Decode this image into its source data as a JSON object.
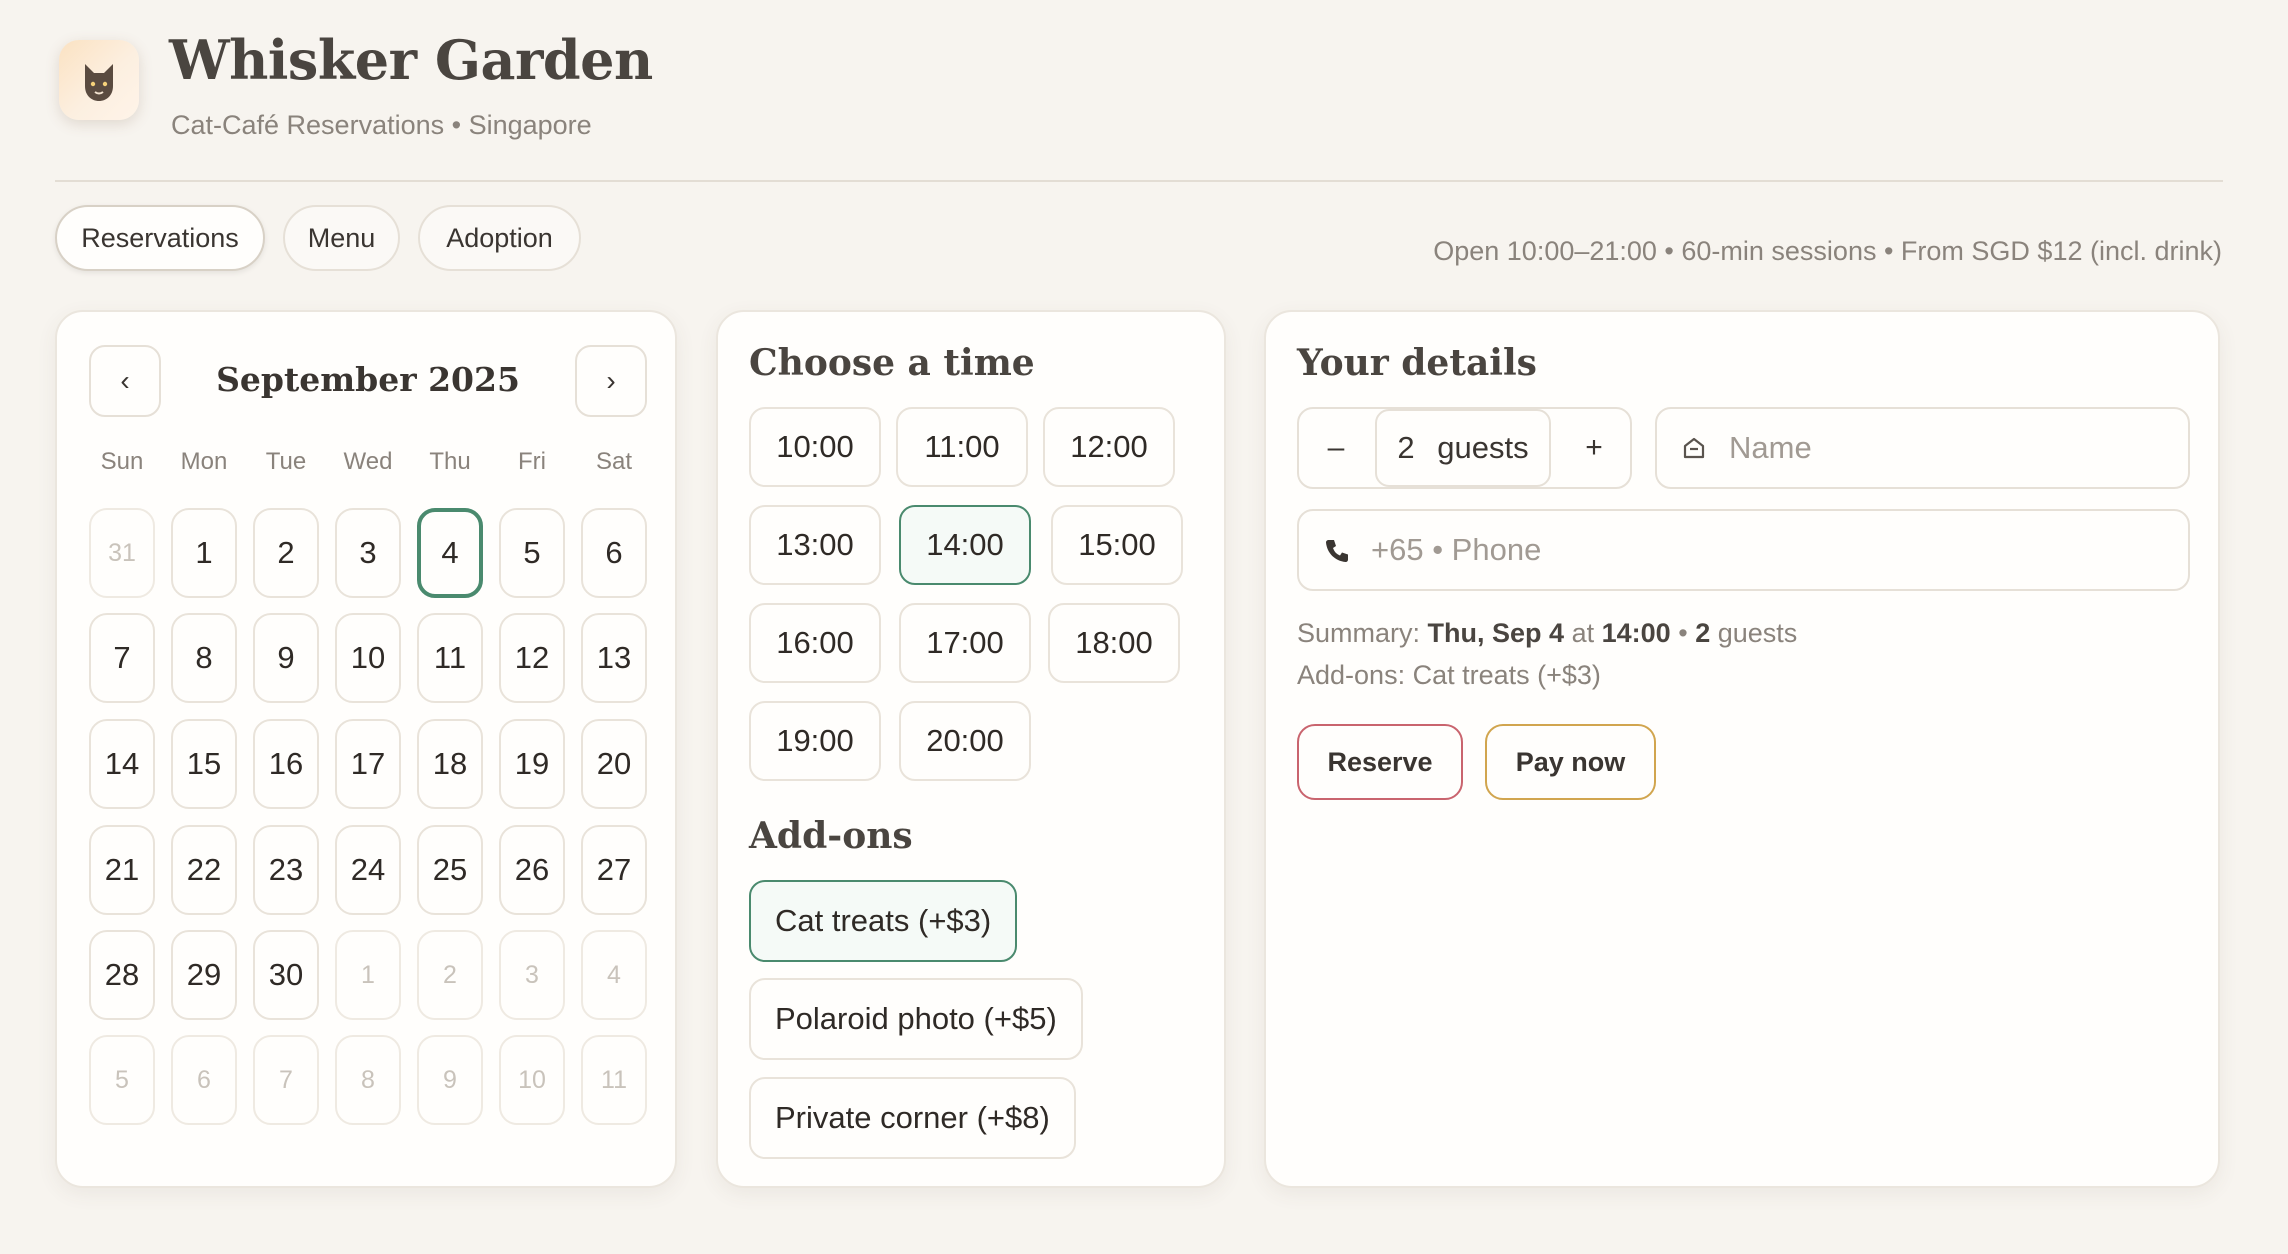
{
  "brand": {
    "name": "Whisker Garden",
    "subtitle": "Cat-Café Reservations • Singapore"
  },
  "tabs": [
    {
      "label": "Reservations",
      "active": true
    },
    {
      "label": "Menu",
      "active": false
    },
    {
      "label": "Adoption",
      "active": false
    }
  ],
  "info": "Open 10:00–21:00 • 60-min sessions • From SGD $12 (incl. drink)",
  "calendar": {
    "month": "September 2025",
    "prev": "‹",
    "next": "›",
    "weekdays": [
      "Sun",
      "Mon",
      "Tue",
      "Wed",
      "Thu",
      "Fri",
      "Sat"
    ],
    "days": [
      {
        "d": "31",
        "m": true
      },
      {
        "d": "1"
      },
      {
        "d": "2"
      },
      {
        "d": "3"
      },
      {
        "d": "4",
        "sel": true
      },
      {
        "d": "5"
      },
      {
        "d": "6"
      },
      {
        "d": "7"
      },
      {
        "d": "8"
      },
      {
        "d": "9"
      },
      {
        "d": "10"
      },
      {
        "d": "11"
      },
      {
        "d": "12"
      },
      {
        "d": "13"
      },
      {
        "d": "14"
      },
      {
        "d": "15"
      },
      {
        "d": "16"
      },
      {
        "d": "17"
      },
      {
        "d": "18"
      },
      {
        "d": "19"
      },
      {
        "d": "20"
      },
      {
        "d": "21"
      },
      {
        "d": "22"
      },
      {
        "d": "23"
      },
      {
        "d": "24"
      },
      {
        "d": "25"
      },
      {
        "d": "26"
      },
      {
        "d": "27"
      },
      {
        "d": "28"
      },
      {
        "d": "29"
      },
      {
        "d": "30"
      },
      {
        "d": "1",
        "m": true
      },
      {
        "d": "2",
        "m": true
      },
      {
        "d": "3",
        "m": true
      },
      {
        "d": "4",
        "m": true
      },
      {
        "d": "5",
        "m": true
      },
      {
        "d": "6",
        "m": true
      },
      {
        "d": "7",
        "m": true
      },
      {
        "d": "8",
        "m": true
      },
      {
        "d": "9",
        "m": true
      },
      {
        "d": "10",
        "m": true
      },
      {
        "d": "11",
        "m": true
      }
    ]
  },
  "times": {
    "title": "Choose a time",
    "slots": [
      "10:00",
      "11:00",
      "12:00",
      "13:00",
      "14:00",
      "15:00",
      "16:00",
      "17:00",
      "18:00",
      "19:00",
      "20:00"
    ],
    "selected": "14:00"
  },
  "addons": {
    "title": "Add-ons",
    "items": [
      {
        "label": "Cat treats (+$3)",
        "selected": true
      },
      {
        "label": "Polaroid photo (+$5)",
        "selected": false
      },
      {
        "label": "Private corner (+$8)",
        "selected": false
      }
    ]
  },
  "details": {
    "title": "Your details",
    "minus": "–",
    "plus": "+",
    "guests": "2",
    "guests_label": "guests",
    "name_placeholder": "Name",
    "phone_placeholder": "+65 • Phone",
    "summary_prefix": "Summary:",
    "summary_date": "Thu, Sep 4",
    "summary_at": "at",
    "summary_time": "14:00",
    "summary_sep": "•",
    "summary_guests": "2",
    "summary_guests_label": "guests",
    "addons_line": "Add-ons: Cat treats (+$3)",
    "reserve_label": "Reserve",
    "pay_label": "Pay now"
  },
  "colors": {
    "accent": "#4a8a6e",
    "reserve_border": "#c9646e",
    "pay_border": "#d1a54e"
  }
}
